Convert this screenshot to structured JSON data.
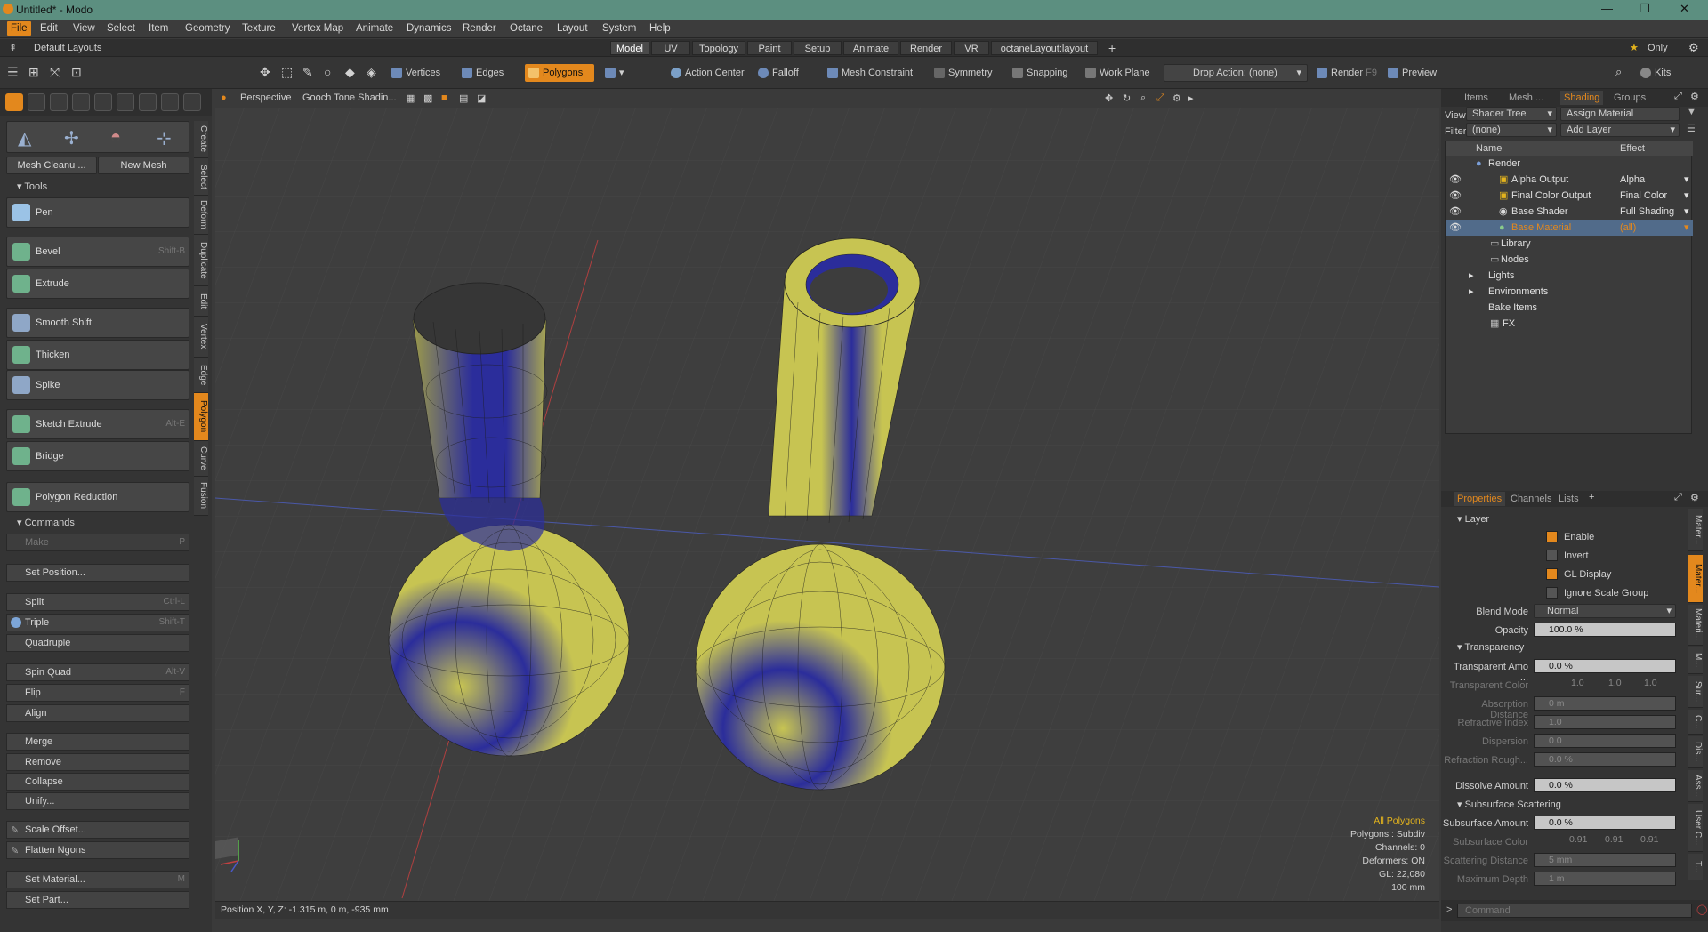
{
  "titlebar": {
    "title": "Untitled* - Modo"
  },
  "menu": [
    "File",
    "Edit",
    "View",
    "Select",
    "Item",
    "Geometry",
    "Texture",
    "Vertex Map",
    "Animate",
    "Dynamics",
    "Render",
    "Octane",
    "Layout",
    "System",
    "Help"
  ],
  "layoutbar": {
    "layouts_label": "Default Layouts",
    "tabs": [
      "Model",
      "UV",
      "Topology",
      "Paint",
      "Setup",
      "Animate",
      "Render",
      "VR",
      "octaneLayout:layout"
    ],
    "only_label": "Only"
  },
  "toolbar": {
    "vertices": "Vertices",
    "edges": "Edges",
    "polygons": "Polygons",
    "action_center": "Action Center",
    "falloff": "Falloff",
    "mesh_constraint": "Mesh Constraint",
    "symmetry": "Symmetry",
    "snapping": "Snapping",
    "work_plane": "Work Plane",
    "drop_action": "Drop Action: (none)",
    "render": "Render",
    "render_key": "F9",
    "preview": "Preview",
    "kits": "Kits"
  },
  "leftpanel": {
    "vtabs": [
      "Create",
      "Select",
      "Deform",
      "Duplicate",
      "Edit",
      "Vertex",
      "Edge",
      "Polygon",
      "Curve",
      "Fusion"
    ],
    "mesh_cleanup": "Mesh Cleanu ...",
    "new_mesh": "New Mesh",
    "tools_header": "Tools",
    "tools": [
      {
        "label": "Pen",
        "shortcut": ""
      },
      {
        "label": "Bevel",
        "shortcut": "Shift-B"
      },
      {
        "label": "Extrude",
        "shortcut": ""
      },
      {
        "label": "Smooth Shift",
        "shortcut": ""
      },
      {
        "label": "Thicken",
        "shortcut": ""
      },
      {
        "label": "Spike",
        "shortcut": ""
      },
      {
        "label": "Sketch Extrude",
        "shortcut": "Alt-E"
      },
      {
        "label": "Bridge",
        "shortcut": ""
      },
      {
        "label": "Polygon Reduction",
        "shortcut": ""
      }
    ],
    "commands_header": "Commands",
    "make": "Make",
    "make_key": "P",
    "set_position": "Set Position...",
    "split": "Split",
    "split_key": "Ctrl-L",
    "triple": "Triple",
    "triple_key": "Shift-T",
    "quadruple": "Quadruple",
    "spin_quad": "Spin Quad",
    "spin_key": "Alt-V",
    "flip": "Flip",
    "flip_key": "F",
    "align": "Align",
    "merge": "Merge",
    "remove": "Remove",
    "collapse": "Collapse",
    "unify": "Unify...",
    "scale_offset": "Scale Offset...",
    "flatten": "Flatten Ngons",
    "set_material": "Set Material...",
    "set_material_key": "M",
    "set_part": "Set Part..."
  },
  "viewport": {
    "view": "Perspective",
    "shading": "Gooch Tone Shadin...",
    "info": [
      "All Polygons",
      "Polygons : Subdiv",
      "Channels: 0",
      "Deformers: ON",
      "GL: 22,080",
      "100 mm"
    ],
    "status": "Position X, Y, Z:   -1.315 m, 0 m, -935 mm",
    "colors": {
      "yellow": "#c7c452",
      "blue": "#2b2d9b",
      "selection": "#e3881d"
    }
  },
  "shader": {
    "tabs": [
      "Items",
      "Mesh ...",
      "Shading",
      "Groups"
    ],
    "view_label": "View",
    "view_value": "Shader Tree",
    "assign": "Assign Material",
    "filter_label": "Filter",
    "filter_value": "(none)",
    "add_layer": "Add Layer",
    "col_name": "Name",
    "col_effect": "Effect",
    "rows": [
      {
        "name": "Render",
        "effect": ""
      },
      {
        "name": "Alpha Output",
        "effect": "Alpha"
      },
      {
        "name": "Final Color Output",
        "effect": "Final Color"
      },
      {
        "name": "Base Shader",
        "effect": "Full Shading"
      },
      {
        "name": "Base Material",
        "effect": "(all)"
      },
      {
        "name": "Library",
        "effect": ""
      },
      {
        "name": "Nodes",
        "effect": ""
      },
      {
        "name": "Lights",
        "effect": ""
      },
      {
        "name": "Environments",
        "effect": ""
      },
      {
        "name": "Bake Items",
        "effect": ""
      },
      {
        "name": "FX",
        "effect": ""
      }
    ]
  },
  "properties": {
    "tabs": [
      "Properties",
      "Channels",
      "Lists"
    ],
    "layer_header": "Layer",
    "enable": "Enable",
    "invert": "Invert",
    "gl_display": "GL Display",
    "ignore_scale": "Ignore Scale Group",
    "blend_mode_label": "Blend Mode",
    "blend_mode": "Normal",
    "opacity_label": "Opacity",
    "opacity": "100.0 %",
    "transparency_header": "Transparency",
    "transp_amount_label": "Transparent Amo ...",
    "transp_amount": "0.0 %",
    "transp_color_label": "Transparent Color",
    "transp_color": [
      "1.0",
      "1.0",
      "1.0"
    ],
    "absorption_label": "Absorption Distance",
    "absorption": "0 m",
    "refr_index_label": "Refractive Index",
    "refr_index": "1.0",
    "dispersion_label": "Dispersion",
    "dispersion": "0.0",
    "refr_rough_label": "Refraction Rough...",
    "refr_rough": "0.0 %",
    "dissolve_label": "Dissolve Amount",
    "dissolve": "0.0 %",
    "sss_header": "Subsurface Scattering",
    "sss_amount_label": "Subsurface Amount",
    "sss_amount": "0.0 %",
    "sss_color_label": "Subsurface Color",
    "sss_color": [
      "0.91",
      "0.91",
      "0.91"
    ],
    "scat_dist_label": "Scattering Distance",
    "scat_dist": "5 mm",
    "max_depth_label": "Maximum Depth",
    "max_depth": "1 m",
    "side_tabs": [
      "Mater...",
      "Mater...",
      "Materi...",
      "M...",
      "Sur...",
      "C...",
      "Dis...",
      "Ass...",
      "User C...",
      "T..."
    ],
    "command_placeholder": "Command"
  }
}
